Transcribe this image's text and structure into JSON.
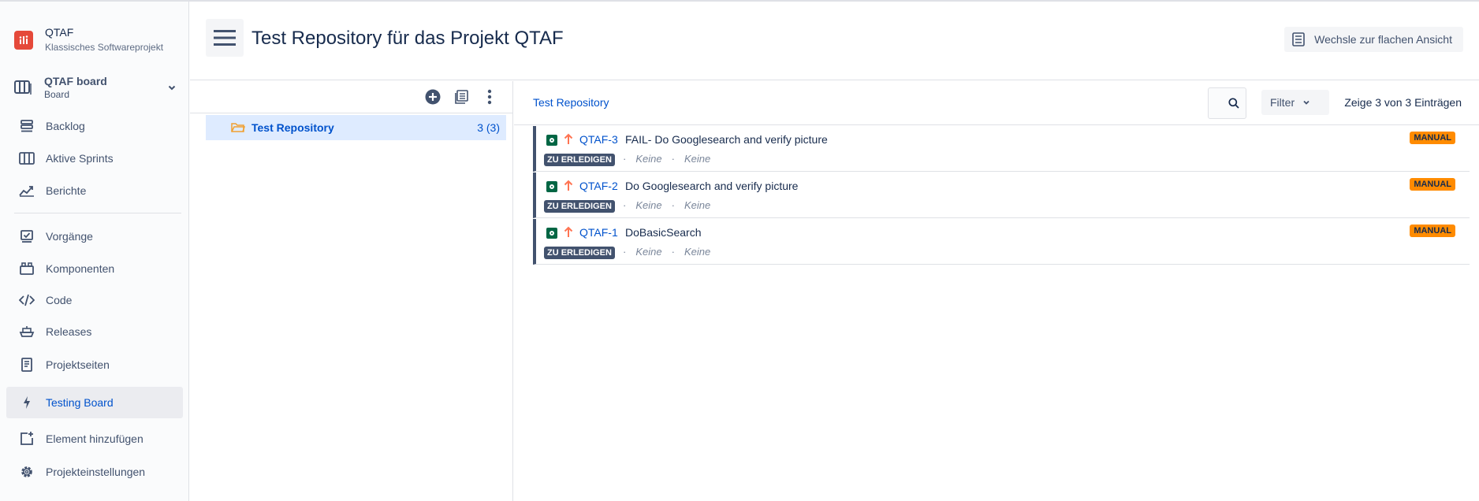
{
  "project": {
    "name": "QTAF",
    "type": "Klassisches Softwareprojekt"
  },
  "board_selector": {
    "name": "QTAF board",
    "sub": "Board"
  },
  "sidebar": {
    "items": [
      {
        "label": "Backlog",
        "icon": "backlog-icon"
      },
      {
        "label": "Aktive Sprints",
        "icon": "sprints-icon"
      },
      {
        "label": "Berichte",
        "icon": "reports-icon"
      },
      {
        "label": "Vorgänge",
        "icon": "issues-icon"
      },
      {
        "label": "Komponenten",
        "icon": "components-icon"
      },
      {
        "label": "Code",
        "icon": "code-icon"
      },
      {
        "label": "Releases",
        "icon": "releases-icon"
      },
      {
        "label": "Projektseiten",
        "icon": "pages-icon"
      },
      {
        "label": "Testing Board",
        "icon": "lightning-icon",
        "active": true
      },
      {
        "label": "Element hinzufügen",
        "icon": "add-item-icon"
      },
      {
        "label": "Projekteinstellungen",
        "icon": "gear-icon"
      }
    ]
  },
  "header": {
    "title": "Test Repository für das Projekt QTAF",
    "flat_view_label": "Wechsle zur flachen Ansicht"
  },
  "tree": {
    "folder": {
      "label": "Test Repository",
      "count": "3 (3)"
    }
  },
  "list": {
    "breadcrumb": "Test Repository",
    "filter_label": "Filter",
    "count_text": "Zeige 3 von 3 Einträgen",
    "issues": [
      {
        "key": "QTAF-3",
        "summary": "FAIL- Do Googlesearch and verify picture",
        "status": "ZU ERLEDIGEN",
        "meta1": "Keine",
        "meta2": "Keine",
        "label": "MANUAL"
      },
      {
        "key": "QTAF-2",
        "summary": "Do Googlesearch and verify picture",
        "status": "ZU ERLEDIGEN",
        "meta1": "Keine",
        "meta2": "Keine",
        "label": "MANUAL"
      },
      {
        "key": "QTAF-1",
        "summary": "DoBasicSearch",
        "status": "ZU ERLEDIGEN",
        "meta1": "Keine",
        "meta2": "Keine",
        "label": "MANUAL"
      }
    ]
  },
  "colors": {
    "accent": "#0052cc",
    "brand": "#e5493a",
    "manual": "#ff8b00",
    "status": "#42526e"
  }
}
